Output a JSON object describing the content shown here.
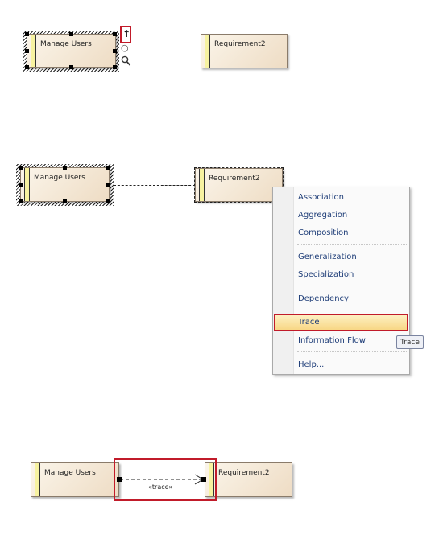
{
  "panel1": {
    "manage_users": "Manage Users",
    "requirement": "Requirement2",
    "quicklinker_arrow": "↑",
    "quicklinker_circle": "○",
    "quicklinker_search": "🔍"
  },
  "panel2": {
    "manage_users": "Manage Users",
    "requirement": "Requirement2",
    "menu_items": [
      "Association",
      "Aggregation",
      "Composition",
      "Generalization",
      "Specialization",
      "Dependency",
      "Trace",
      "Information Flow",
      "Help..."
    ],
    "tooltip": "Trace"
  },
  "panel3": {
    "manage_users": "Manage Users",
    "requirement": "Requirement2",
    "connector_label": "«trace»"
  },
  "colors": {
    "highlight_border": "#c11b2a",
    "menu_text": "#1d3c77",
    "element_fill": "#eedcc4",
    "element_bar": "#f7f2a0"
  }
}
